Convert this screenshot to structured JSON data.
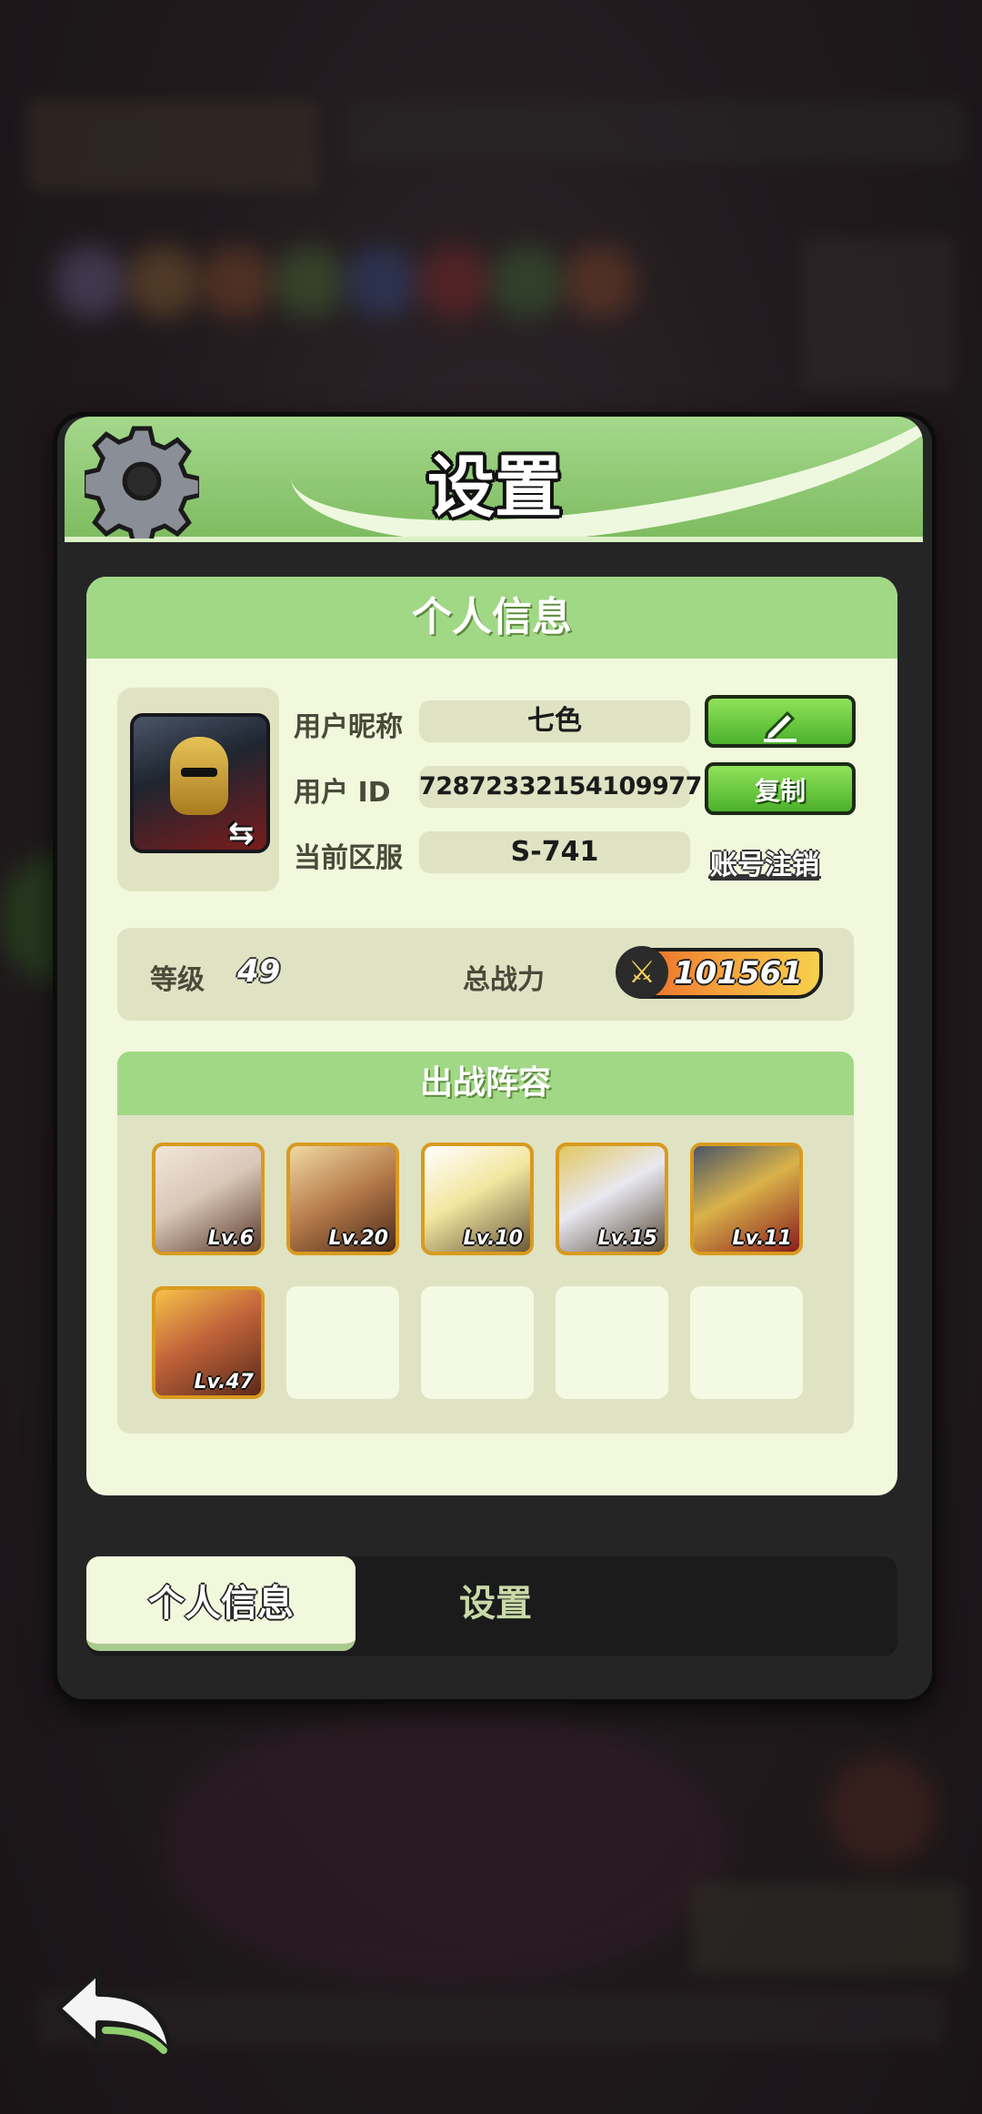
{
  "panel": {
    "title": "设置"
  },
  "profile": {
    "section_title": "个人信息",
    "nickname_label": "用户昵称",
    "nickname": "七色",
    "id_label": "用户  ID",
    "user_id": "72872332154109977",
    "server_label": "当前区服",
    "server": "S-741",
    "copy_button": "复制",
    "cancel_account_link": "账号注销",
    "level_label": "等级",
    "level": "49",
    "power_label": "总战力",
    "power": "101561"
  },
  "lineup": {
    "title": "出战阵容",
    "heroes": [
      {
        "level": "Lv.6"
      },
      {
        "level": "Lv.20"
      },
      {
        "level": "Lv.10"
      },
      {
        "level": "Lv.15"
      },
      {
        "level": "Lv.11"
      },
      {
        "level": "Lv.47"
      }
    ],
    "empty_slots": 4
  },
  "tabs": {
    "active": "个人信息",
    "inactive": "设置"
  },
  "icons": {
    "settings": "gear-icon",
    "edit": "pencil-icon",
    "swap_avatar": "swap-arrows-icon",
    "power": "crossed-swords-icon",
    "back": "back-arrow-icon"
  },
  "colors": {
    "header_green": "#8fc873",
    "card_bg": "#f1f8dc",
    "button_green": "#5dbf33",
    "hero_border": "#d99a1f"
  }
}
